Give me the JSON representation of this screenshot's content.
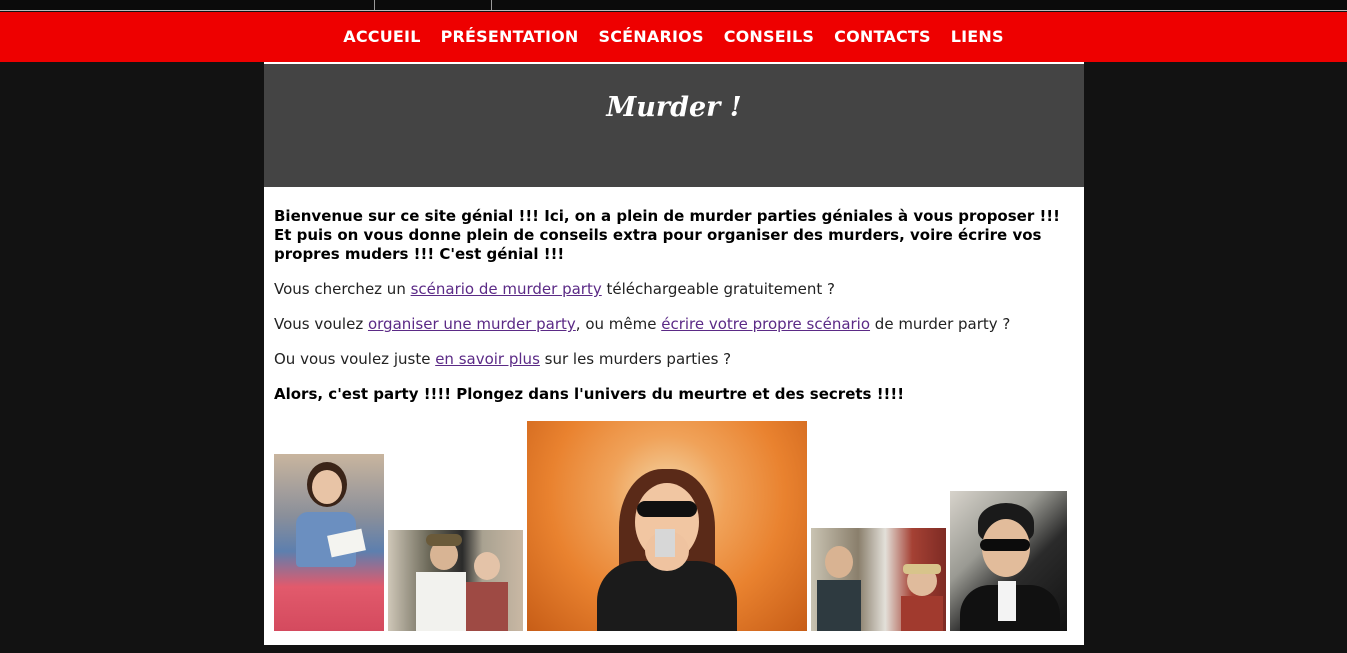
{
  "nav": {
    "items": [
      "ACCUEIL",
      "PRÉSENTATION",
      "SCÉNARIOS",
      "CONSEILS",
      "CONTACTS",
      "LIENS"
    ]
  },
  "hero": {
    "title": "Murder !"
  },
  "content": {
    "intro": "Bienvenue sur ce site génial !!! Ici, on a plein de murder parties géniales à vous proposer !!! Et puis on vous donne plein de conseils extra pour organiser des murders, voire écrire vos propres muders !!! C'est génial !!!",
    "p1": {
      "before": "Vous cherchez un ",
      "link": "scénario de murder party",
      "after": " téléchargeable gratuitement ?"
    },
    "p2": {
      "before": "Vous voulez ",
      "link1": "organiser une murder party",
      "middle": ", ou même ",
      "link2": "écrire votre propre scénario",
      "after": " de murder party ?"
    },
    "p3": {
      "before": "Ou vous voulez juste ",
      "link": "en savoir plus",
      "after": " sur les murders parties ?"
    },
    "closing": "Alors, c'est party !!!! Plongez dans l'univers du meurtre et des secrets !!!!"
  },
  "colors": {
    "nav_bg": "#ee0000",
    "hero_bg": "#444444",
    "page_bg": "#121212",
    "link": "#5b2a86"
  }
}
